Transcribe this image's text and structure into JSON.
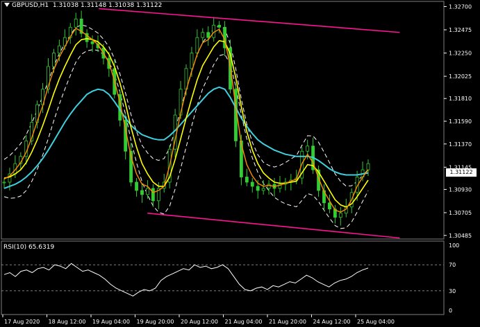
{
  "header": {
    "symbol": "GBPUSD,H1",
    "ohlc": "1.31038 1.31148 1.31038 1.31122"
  },
  "current_price": "1.31122",
  "rsi_header": "RSI(10) 65.6319",
  "colors": {
    "background": "#000000",
    "candles": "#32cd32",
    "ma_fast": "#ff8c00",
    "ma_mid": "#ffff00",
    "ma_slow": "#3fd0e0",
    "envelope": "#ffffff",
    "channel": "#ff1493",
    "rsi_line": "#ffffff",
    "grid": "#808080"
  },
  "chart_data": [
    {
      "type": "line",
      "title": "GBPUSD,H1",
      "price_ticks": [
        "1.32700",
        "1.32475",
        "1.32250",
        "1.32025",
        "1.31810",
        "1.31590",
        "1.31370",
        "1.31145",
        "1.30930",
        "1.30705",
        "1.30485"
      ],
      "price_tick_values": [
        1.327,
        1.32475,
        1.3225,
        1.32025,
        1.3181,
        1.3159,
        1.3137,
        1.31145,
        1.3093,
        1.30705,
        1.30485
      ],
      "x_ticks": [
        "17 Aug 2020",
        "18 Aug 12:00",
        "19 Aug 04:00",
        "19 Aug 20:00",
        "20 Aug 12:00",
        "21 Aug 04:00",
        "21 Aug 20:00",
        "24 Aug 12:00",
        "25 Aug 04:00"
      ],
      "ylim": [
        1.3045,
        1.3275
      ],
      "x_count": 93,
      "series": [
        {
          "key": "price",
          "values": [
            1.31,
            1.3108,
            1.3118,
            1.3125,
            1.314,
            1.3158,
            1.3175,
            1.319,
            1.3212,
            1.3225,
            1.3232,
            1.324,
            1.325,
            1.3258,
            1.3244,
            1.3236,
            1.3234,
            1.323,
            1.322,
            1.321,
            1.3185,
            1.316,
            1.313,
            1.31,
            1.3092,
            1.3088,
            1.3094,
            1.3082,
            1.3094,
            1.31,
            1.3132,
            1.3165,
            1.319,
            1.321,
            1.3225,
            1.324,
            1.3245,
            1.324,
            1.3252,
            1.325,
            1.323,
            1.319,
            1.314,
            1.3105,
            1.31,
            1.3096,
            1.3092,
            1.3094,
            1.3098,
            1.3094,
            1.3098,
            1.31,
            1.3102,
            1.3104,
            1.313,
            1.3135,
            1.3112,
            1.3092,
            1.308,
            1.3074,
            1.3066,
            1.307,
            1.3076,
            1.309,
            1.3105,
            1.3112,
            1.3118
          ]
        },
        {
          "key": "ma_fast",
          "values": [
            1.3103,
            1.3106,
            1.3112,
            1.3119,
            1.3129,
            1.3143,
            1.3159,
            1.3174,
            1.3193,
            1.3209,
            1.3221,
            1.3231,
            1.3241,
            1.3249,
            1.3246,
            1.3242,
            1.3238,
            1.3233,
            1.3225,
            1.3216,
            1.3198,
            1.3177,
            1.3151,
            1.3125,
            1.3108,
            1.3098,
            1.3096,
            1.309,
            1.3092,
            1.3096,
            1.3116,
            1.3141,
            1.3167,
            1.3189,
            1.3207,
            1.3224,
            1.3235,
            1.3238,
            1.3245,
            1.3248,
            1.3238,
            1.3212,
            1.3173,
            1.3137,
            1.3117,
            1.3106,
            1.3099,
            1.3096,
            1.3097,
            1.3096,
            1.3097,
            1.3099,
            1.3101,
            1.3103,
            1.3118,
            1.3127,
            1.3119,
            1.3104,
            1.3091,
            1.3082,
            1.3073,
            1.3071,
            1.3074,
            1.3083,
            1.3096,
            1.3105,
            1.3112
          ]
        },
        {
          "key": "ma_mid",
          "values": [
            1.3104,
            1.3105,
            1.3108,
            1.3112,
            1.3119,
            1.3129,
            1.3141,
            1.3155,
            1.317,
            1.3186,
            1.32,
            1.3212,
            1.3223,
            1.3233,
            1.3238,
            1.3239,
            1.3238,
            1.3236,
            1.3231,
            1.3224,
            1.3212,
            1.3196,
            1.3176,
            1.3153,
            1.3134,
            1.3118,
            1.3108,
            1.31,
            1.3096,
            1.3096,
            1.3105,
            1.3122,
            1.3142,
            1.3162,
            1.3181,
            1.3199,
            1.3213,
            1.3222,
            1.3231,
            1.3237,
            1.3236,
            1.3224,
            1.3201,
            1.3173,
            1.3149,
            1.3131,
            1.3118,
            1.3109,
            1.3104,
            1.31,
            1.3099,
            1.3099,
            1.31,
            1.3101,
            1.3109,
            1.3117,
            1.3116,
            1.311,
            1.3101,
            1.3092,
            1.3083,
            1.3078,
            1.3076,
            1.3079,
            1.3086,
            1.3094,
            1.3102
          ]
        },
        {
          "key": "ma_slow",
          "values": [
            1.3094,
            1.3096,
            1.3098,
            1.3101,
            1.3105,
            1.311,
            1.3116,
            1.3123,
            1.3131,
            1.314,
            1.3149,
            1.3158,
            1.3166,
            1.3173,
            1.3179,
            1.3185,
            1.3188,
            1.319,
            1.3189,
            1.3185,
            1.3178,
            1.317,
            1.3162,
            1.3155,
            1.315,
            1.3146,
            1.3144,
            1.3142,
            1.3141,
            1.3141,
            1.3145,
            1.315,
            1.3156,
            1.3162,
            1.3168,
            1.3174,
            1.318,
            1.3186,
            1.319,
            1.3192,
            1.319,
            1.3182,
            1.3172,
            1.3162,
            1.3154,
            1.3147,
            1.3141,
            1.3137,
            1.3134,
            1.3131,
            1.3129,
            1.3127,
            1.3126,
            1.3125,
            1.3125,
            1.3125,
            1.3124,
            1.3121,
            1.3117,
            1.3113,
            1.311,
            1.3108,
            1.3107,
            1.3107,
            1.3107,
            1.3108,
            1.3109
          ]
        }
      ],
      "channel_upper": [
        {
          "x": 0.22,
          "y": 1.3268
        },
        {
          "x": 0.9,
          "y": 1.3245
        }
      ],
      "channel_lower": [
        {
          "x": 0.33,
          "y": 1.307
        },
        {
          "x": 0.9,
          "y": 1.3046
        }
      ]
    },
    {
      "type": "line",
      "title": "RSI(10) 65.6319",
      "rsi_ticks": [
        "100",
        "70",
        "30",
        "0"
      ],
      "rsi_tick_values": [
        100,
        70,
        30,
        0
      ],
      "ylim": [
        0,
        100
      ],
      "levels": [
        70,
        30
      ],
      "series": [
        {
          "key": "rsi",
          "values": [
            55,
            58,
            52,
            60,
            62,
            58,
            64,
            66,
            62,
            70,
            68,
            64,
            72,
            66,
            60,
            62,
            58,
            54,
            48,
            40,
            34,
            30,
            26,
            22,
            28,
            32,
            30,
            34,
            46,
            52,
            56,
            60,
            64,
            62,
            70,
            66,
            68,
            64,
            66,
            70,
            64,
            52,
            40,
            32,
            30,
            34,
            36,
            32,
            38,
            36,
            40,
            44,
            42,
            48,
            54,
            50,
            44,
            40,
            36,
            42,
            46,
            48,
            52,
            58,
            62,
            65
          ]
        }
      ]
    }
  ]
}
